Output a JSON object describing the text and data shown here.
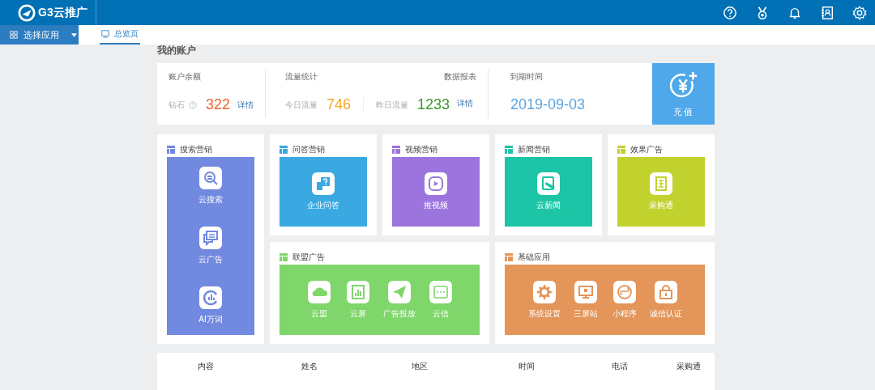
{
  "header": {
    "logo_text": "G3云推广"
  },
  "app_menu": {
    "label": "选择应用"
  },
  "tabs": [
    {
      "label": "总览页",
      "selected": true
    }
  ],
  "account": {
    "title": "我的账户",
    "balance": {
      "label": "账户余额",
      "item": "钻石",
      "value": "322",
      "link": "详情"
    },
    "traffic": {
      "label": "流量统计",
      "report_link": "数据报表",
      "today_label": "今日流量",
      "today_value": "746",
      "yesterday_label": "昨日流量",
      "yesterday_value": "1233",
      "link": "详情"
    },
    "expiry": {
      "label": "到期时间",
      "value": "2019-09-03"
    },
    "recharge": {
      "label": "充值"
    }
  },
  "sections": [
    {
      "kind": "tall",
      "title": "搜索营销",
      "color": "#7289e0",
      "items": [
        "云搜索",
        "云广告",
        "AI万词"
      ]
    },
    {
      "kind": "small",
      "title": "问答营销",
      "color": "#3aa9e2",
      "items": [
        "企业问答"
      ]
    },
    {
      "kind": "small",
      "title": "视频营销",
      "color": "#9b74dd",
      "items": [
        "推视频"
      ]
    },
    {
      "kind": "small",
      "title": "新闻营销",
      "color": "#1cc5a5",
      "items": [
        "云新闻"
      ]
    },
    {
      "kind": "small",
      "title": "效果广告",
      "color": "#c1d22f",
      "items": [
        "采购通"
      ]
    },
    {
      "kind": "wide",
      "title": "联盟广告",
      "color": "#7fd66a",
      "items": [
        "云盟",
        "云屏",
        "广告投放",
        "云信"
      ]
    },
    {
      "kind": "wide",
      "title": "基础应用",
      "color": "#e3955a",
      "items": [
        "系统设置",
        "三屏站",
        "小程序",
        "诚信认证"
      ]
    }
  ],
  "table": {
    "columns": [
      "内容",
      "姓名",
      "地区",
      "时间",
      "电话",
      "采购通"
    ]
  }
}
